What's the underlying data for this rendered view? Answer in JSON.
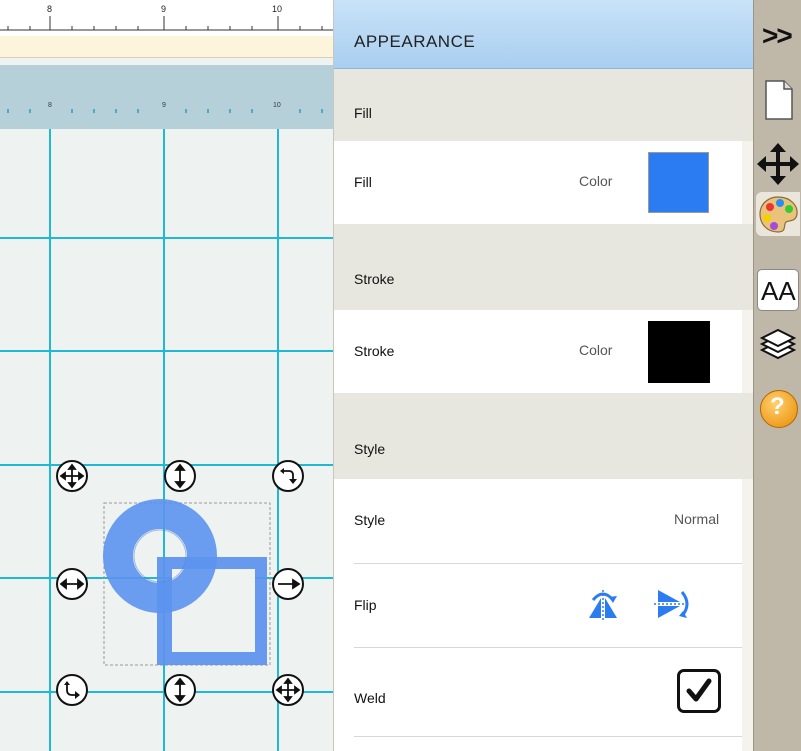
{
  "ruler_top": {
    "ticks": [
      "8",
      "9",
      "10"
    ]
  },
  "ruler_secondary": {
    "ticks": [
      "8",
      "9",
      "10"
    ]
  },
  "panel": {
    "title": "APPEARANCE",
    "sections": {
      "fill": {
        "header": "Fill",
        "row_label": "Fill",
        "sub_label": "Color",
        "swatch_color": "#2b7cf2"
      },
      "stroke": {
        "header": "Stroke",
        "row_label": "Stroke",
        "sub_label": "Color",
        "swatch_color": "#000000"
      },
      "style": {
        "header": "Style",
        "style_label": "Style",
        "style_value": "Normal",
        "flip_label": "Flip",
        "weld_label": "Weld",
        "weld_checked": true
      }
    }
  },
  "toolbar": {
    "collapse_label": ">>",
    "tools": [
      "page-icon",
      "move-icon",
      "palette-icon",
      "text-size-icon",
      "layers-icon",
      "help-icon"
    ],
    "text_tool_label": "AA",
    "help_label": "?"
  },
  "colors": {
    "grid_line": "#1fb9d6",
    "shape_fill": "#5b93ee",
    "accent": "#2b7cf2"
  }
}
